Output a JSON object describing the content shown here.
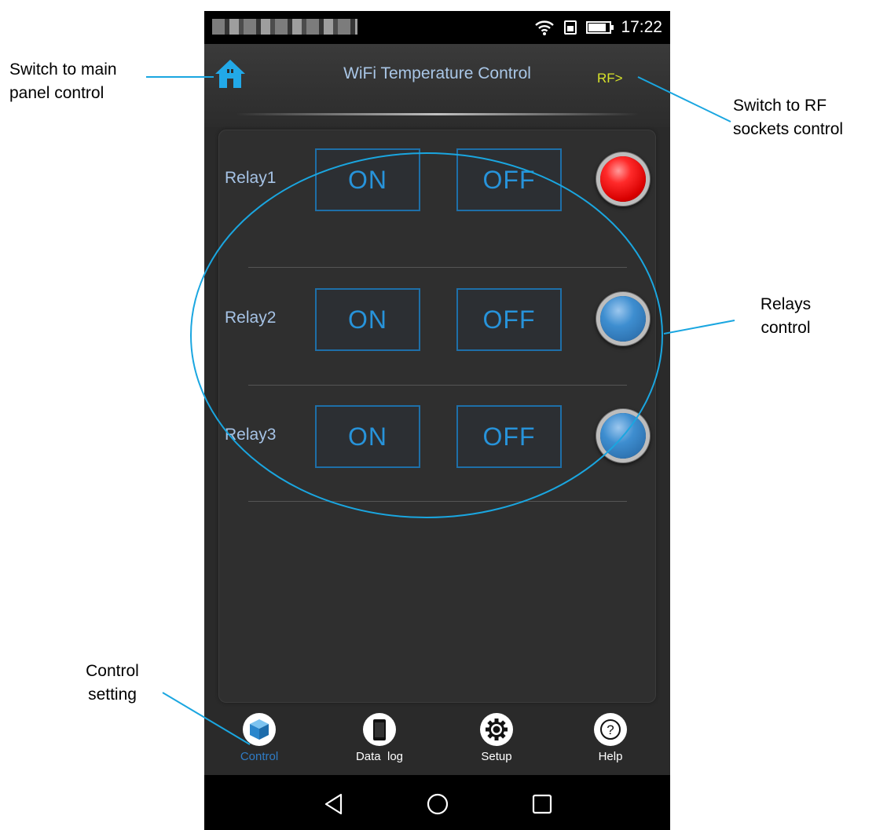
{
  "status_bar": {
    "time": "17:22"
  },
  "app_bar": {
    "title": "WiFi Temperature Control",
    "rf_link": "RF>"
  },
  "relays": [
    {
      "label": "Relay1",
      "on_label": "ON",
      "off_label": "OFF",
      "state": "on",
      "led_color": "#e60000"
    },
    {
      "label": "Relay2",
      "on_label": "ON",
      "off_label": "OFF",
      "state": "off",
      "led_color": "#3a86c8"
    },
    {
      "label": "Relay3",
      "on_label": "ON",
      "off_label": "OFF",
      "state": "off",
      "led_color": "#3a86c8"
    }
  ],
  "bottom_nav": [
    {
      "label": "Control",
      "icon": "cube-icon",
      "active": true
    },
    {
      "label": "Data  log",
      "icon": "phone-icon",
      "active": false
    },
    {
      "label": "Setup",
      "icon": "gear-icon",
      "active": false
    },
    {
      "label": "Help",
      "icon": "help-icon",
      "active": false
    }
  ],
  "annotations": {
    "main_panel": [
      "Switch to main",
      "panel control"
    ],
    "rf_sockets": [
      "Switch to RF",
      "sockets control"
    ],
    "relays_control": [
      "Relays",
      "control"
    ],
    "control_setting": [
      "Control",
      "setting"
    ]
  },
  "colors": {
    "annotation_line": "#1aa6e0",
    "accent_blue": "#2793da",
    "title_text": "#a9c6e6",
    "rf_text": "#d7e22a",
    "home_icon": "#22a9e8"
  }
}
